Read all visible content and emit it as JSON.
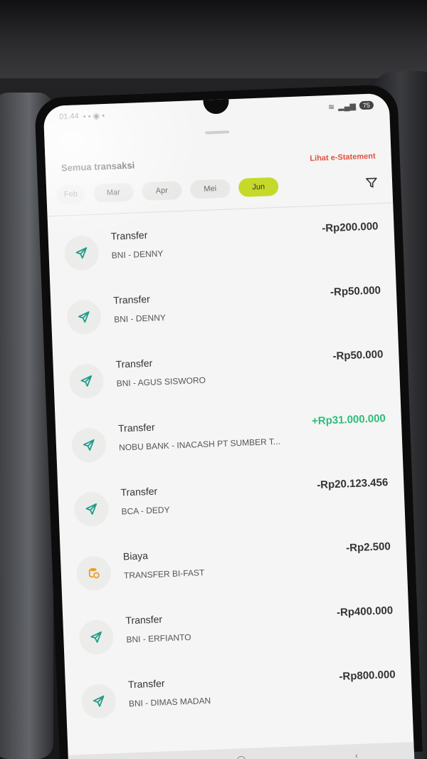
{
  "status_bar": {
    "time": "01.44",
    "battery": "75"
  },
  "header": {
    "title": "Semua transaksi",
    "estatement_link": "Lihat e-Statement"
  },
  "months": [
    "Feb",
    "Mar",
    "Apr",
    "Mei",
    "Jun"
  ],
  "active_month": "Jun",
  "transactions": [
    {
      "title": "Transfer",
      "subtitle": "BNI - DENNY",
      "amount": "-Rp200.000",
      "type": "debit",
      "icon": "send-icon"
    },
    {
      "title": "Transfer",
      "subtitle": "BNI - DENNY",
      "amount": "-Rp50.000",
      "type": "debit",
      "icon": "send-icon"
    },
    {
      "title": "Transfer",
      "subtitle": "BNI - AGUS SISWORO",
      "amount": "-Rp50.000",
      "type": "debit",
      "icon": "send-icon"
    },
    {
      "title": "Transfer",
      "subtitle": "NOBU BANK - INACASH PT SUMBER T...",
      "amount": "+Rp31.000.000",
      "type": "credit",
      "icon": "send-icon"
    },
    {
      "title": "Transfer",
      "subtitle": "BCA - DEDY",
      "amount": "-Rp20.123.456",
      "type": "debit",
      "icon": "send-icon"
    },
    {
      "title": "Biaya",
      "subtitle": "TRANSFER BI-FAST",
      "amount": "-Rp2.500",
      "type": "debit",
      "icon": "coins-icon"
    },
    {
      "title": "Transfer",
      "subtitle": "BNI - ERFIANTO",
      "amount": "-Rp400.000",
      "type": "debit",
      "icon": "send-icon"
    },
    {
      "title": "Transfer",
      "subtitle": "BNI - DIMAS MADAN",
      "amount": "-Rp800.000",
      "type": "debit",
      "icon": "send-icon"
    }
  ],
  "colors": {
    "accent": "#c5d92b",
    "credit": "#2ebd7a",
    "link": "#e0503c",
    "icon_teal": "#1f9d8a",
    "icon_orange": "#e8a02a"
  }
}
